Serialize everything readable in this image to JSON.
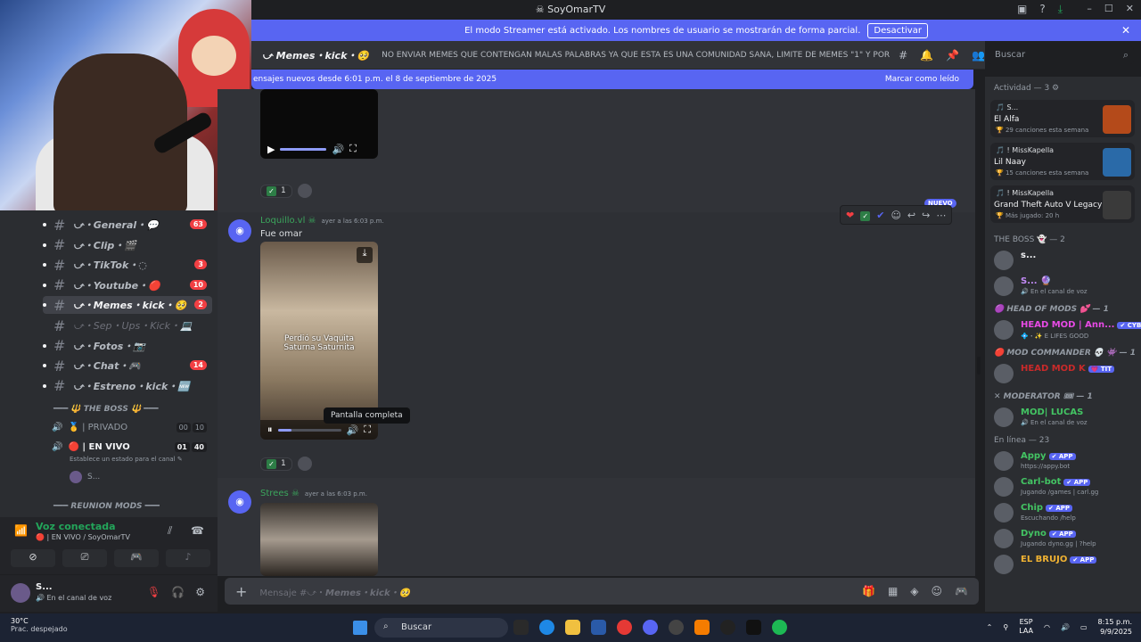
{
  "window": {
    "title": "SoyOmarTV",
    "minimize": "–",
    "maximize": "☐",
    "close": "✕"
  },
  "streamer_banner": {
    "text": "El modo Streamer está activado. Los nombres de usuario se mostrarán de forma parcial.",
    "button": "Desactivar",
    "close": "✕"
  },
  "channel_header": {
    "name": "⤻ Memes・kick・🥺",
    "topic": "NO ENVIAR MEMES QUE CONTENGAN MALAS PALABRAS YA QUE ESTA ES UNA COMUNIDAD SANA, LIMITE DE MEMES \"1\" Y POR ULTIMO EL ...",
    "search_placeholder": "Buscar"
  },
  "new_messages_bar": {
    "text": "ensajes nuevos desde 6:01 p.m. el 8 de septiembre de 2025",
    "action": "Marcar como leído"
  },
  "sidebar": {
    "channels": [
      {
        "name": "⤻・General・💬",
        "badge": "63",
        "active": false,
        "muted": false
      },
      {
        "name": "⤻・Clip・🎬",
        "badge": "",
        "active": false,
        "muted": false
      },
      {
        "name": "⤻・TikTok・◌",
        "badge": "3",
        "active": false,
        "muted": false
      },
      {
        "name": "⤻・Youtube・🔴",
        "badge": "10",
        "active": false,
        "muted": false
      },
      {
        "name": "⤻・Memes・kick・🥺",
        "badge": "2",
        "active": true,
        "muted": false
      },
      {
        "name": "⤻・Sep・Ups・Kick・💻",
        "badge": "",
        "active": false,
        "muted": true
      },
      {
        "name": "⤻・Fotos・📷",
        "badge": "",
        "active": false,
        "muted": false
      },
      {
        "name": "⤻・Chat・🎮",
        "badge": "14",
        "active": false,
        "muted": false
      },
      {
        "name": "⤻・Estreno・kick・🆕",
        "badge": "",
        "active": false,
        "muted": false
      }
    ],
    "category_boss": "━━━ 🔱 THE BOSS 🔱 ━━━",
    "voice_channels": [
      {
        "name": "🥇 | PRIVADO",
        "count_a": "00",
        "count_b": "10"
      },
      {
        "name": "🔴 | EN VIVO",
        "count_a": "01",
        "count_b": "40"
      }
    ],
    "status_hint": "Establece un estado para el canal ✎",
    "voice_user": "S...",
    "category_mods": "━━━ REUNION MODS ━━━"
  },
  "voice_panel": {
    "title": "Voz conectada",
    "subtitle": "🔴 | EN VIVO / SoyOmarTV"
  },
  "user_panel": {
    "name": "S...",
    "status": "🔊 En el canal de voz"
  },
  "messages": [
    {
      "author": "Loquillo.vl",
      "time": "ayer a las 6:03 p.m.",
      "text": "Fue omar",
      "video_caption": "Perdió su Vaquita Saturna Saturnita",
      "reaction_count": "1"
    },
    {
      "author": "Strees",
      "time": "ayer a las 6:03 p.m."
    }
  ],
  "first_reaction_count": "1",
  "tooltip": "Pantalla completa",
  "nuevo_badge": "NUEVO",
  "composer": {
    "placeholder_prefix": "Mensaje #⤻・",
    "placeholder_channel": "Memes・kick・🥺"
  },
  "members": {
    "activity_header": "Actividad — 3 ⚙",
    "activities": [
      {
        "user": "🎵 S...",
        "title": "El Alfa",
        "sub": "🏆 29 canciones esta semana",
        "color": "#b44a1a"
      },
      {
        "user": "🎵 ! MissKapella",
        "title": "Lil Naay",
        "sub": "🏆 15 canciones esta semana",
        "color": "#2a6aa8"
      },
      {
        "user": "🎵 ! MissKapella",
        "title": "Grand Theft Auto V Legacy",
        "sub": "🏆 Más jugado: 20 h",
        "color": "#3a3a3a"
      }
    ],
    "groups": [
      {
        "header": "THE BOSS 👻 — 2",
        "role": false,
        "members": [
          {
            "name": "s...",
            "sub": "",
            "color": "#f2f3f5",
            "tag": ""
          },
          {
            "name": "S... 🔮",
            "sub": "🔊 En el canal de voz",
            "color": "#c38bf7",
            "tag": ""
          }
        ]
      },
      {
        "header": "🟣 HEAD OF MODS 💕 — 1",
        "role": true,
        "members": [
          {
            "name": "HEAD MOD | Ann...",
            "sub": "💠・✨ E LIFES GOOD",
            "color": "#e84ae6",
            "tag": "✔ CYBR"
          }
        ]
      },
      {
        "header": "🔴 MOD COMMANDER 💀 👾 — 1",
        "role": true,
        "members": [
          {
            "name": "HEAD MOD K",
            "sub": "",
            "color": "#c92a2a",
            "tag": "💗 TIT"
          }
        ]
      },
      {
        "header": "✕ MODERATOR 🎟 — 1",
        "role": true,
        "members": [
          {
            "name": "MOD| LUCAS",
            "sub": "🔊 En el canal de voz",
            "color": "#43c463",
            "tag": ""
          }
        ]
      },
      {
        "header": "En línea — 23",
        "role": false,
        "members": [
          {
            "name": "Appy",
            "sub": "https://appy.bot",
            "color": "#43c463",
            "tag": "✔ APP"
          },
          {
            "name": "Carl-bot",
            "sub": "Jugando /games | carl.gg",
            "color": "#43c463",
            "tag": "✔ APP"
          },
          {
            "name": "Chip",
            "sub": "Escuchando /help",
            "color": "#43c463",
            "tag": "✔ APP"
          },
          {
            "name": "Dyno",
            "sub": "Jugando dyno.gg | ?help",
            "color": "#43c463",
            "tag": "✔ APP"
          },
          {
            "name": "EL BRUJO",
            "sub": "",
            "color": "#f0b232",
            "tag": "✔ APP"
          }
        ]
      }
    ]
  },
  "taskbar": {
    "temp": "30°C",
    "weather": "Prac. despejado",
    "search": "Buscar",
    "lang_a": "ESP",
    "lang_b": "LAA",
    "time": "8:15 p.m.",
    "date": "9/9/2025"
  }
}
